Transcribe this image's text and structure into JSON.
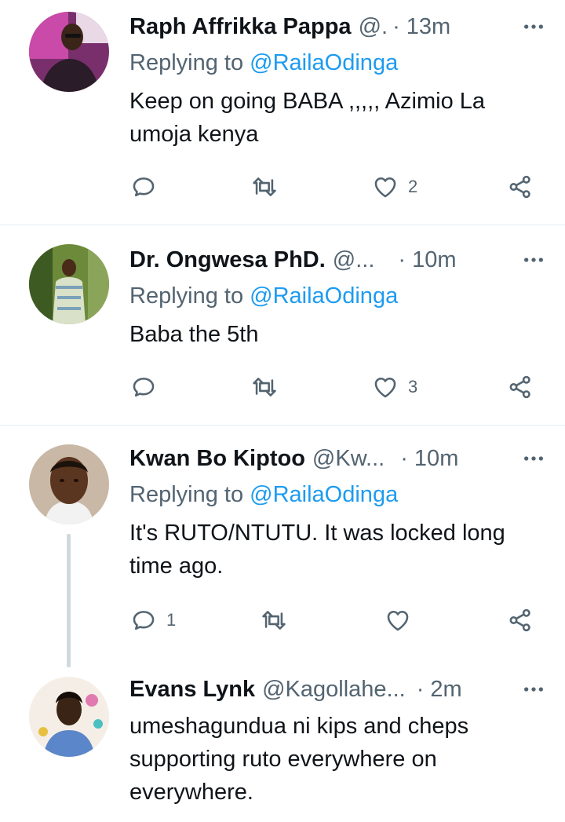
{
  "tweets": [
    {
      "name": "Raph Affrikka Pappa",
      "handle": "@.",
      "time": "· 13m",
      "reply_label": "Replying to",
      "reply_mention": "@RailaOdinga",
      "text": "Keep on going BABA ,,,,, Azimio La umoja kenya",
      "reply_count": "",
      "retweet_count": "",
      "like_count": "2"
    },
    {
      "name": "Dr. Ongwesa PhD.",
      "handle": "@...",
      "time": "· 10m",
      "reply_label": "Replying to",
      "reply_mention": "@RailaOdinga",
      "text": "Baba the 5th",
      "reply_count": "",
      "retweet_count": "",
      "like_count": "3"
    },
    {
      "name": "Kwan Bo Kiptoo",
      "handle": "@Kw...",
      "time": "· 10m",
      "reply_label": "Replying to",
      "reply_mention": "@RailaOdinga",
      "text": "It's RUTO/NTUTU. It was locked long time ago.",
      "reply_count": "1",
      "retweet_count": "",
      "like_count": ""
    },
    {
      "name": "Evans Lynk",
      "handle": "@Kagollahe...",
      "time": "· 2m",
      "text": "umeshagundua ni kips and cheps supporting ruto everywhere on everywhere."
    }
  ],
  "icons": {
    "more": "more-dots-icon",
    "reply": "reply-icon",
    "retweet": "retweet-icon",
    "like": "heart-icon",
    "share": "share-icon"
  },
  "colors": {
    "mention": "#1d9bf0",
    "secondary_text": "#536471",
    "divider": "#e6ecf0",
    "thread_line": "#cfd9de"
  }
}
